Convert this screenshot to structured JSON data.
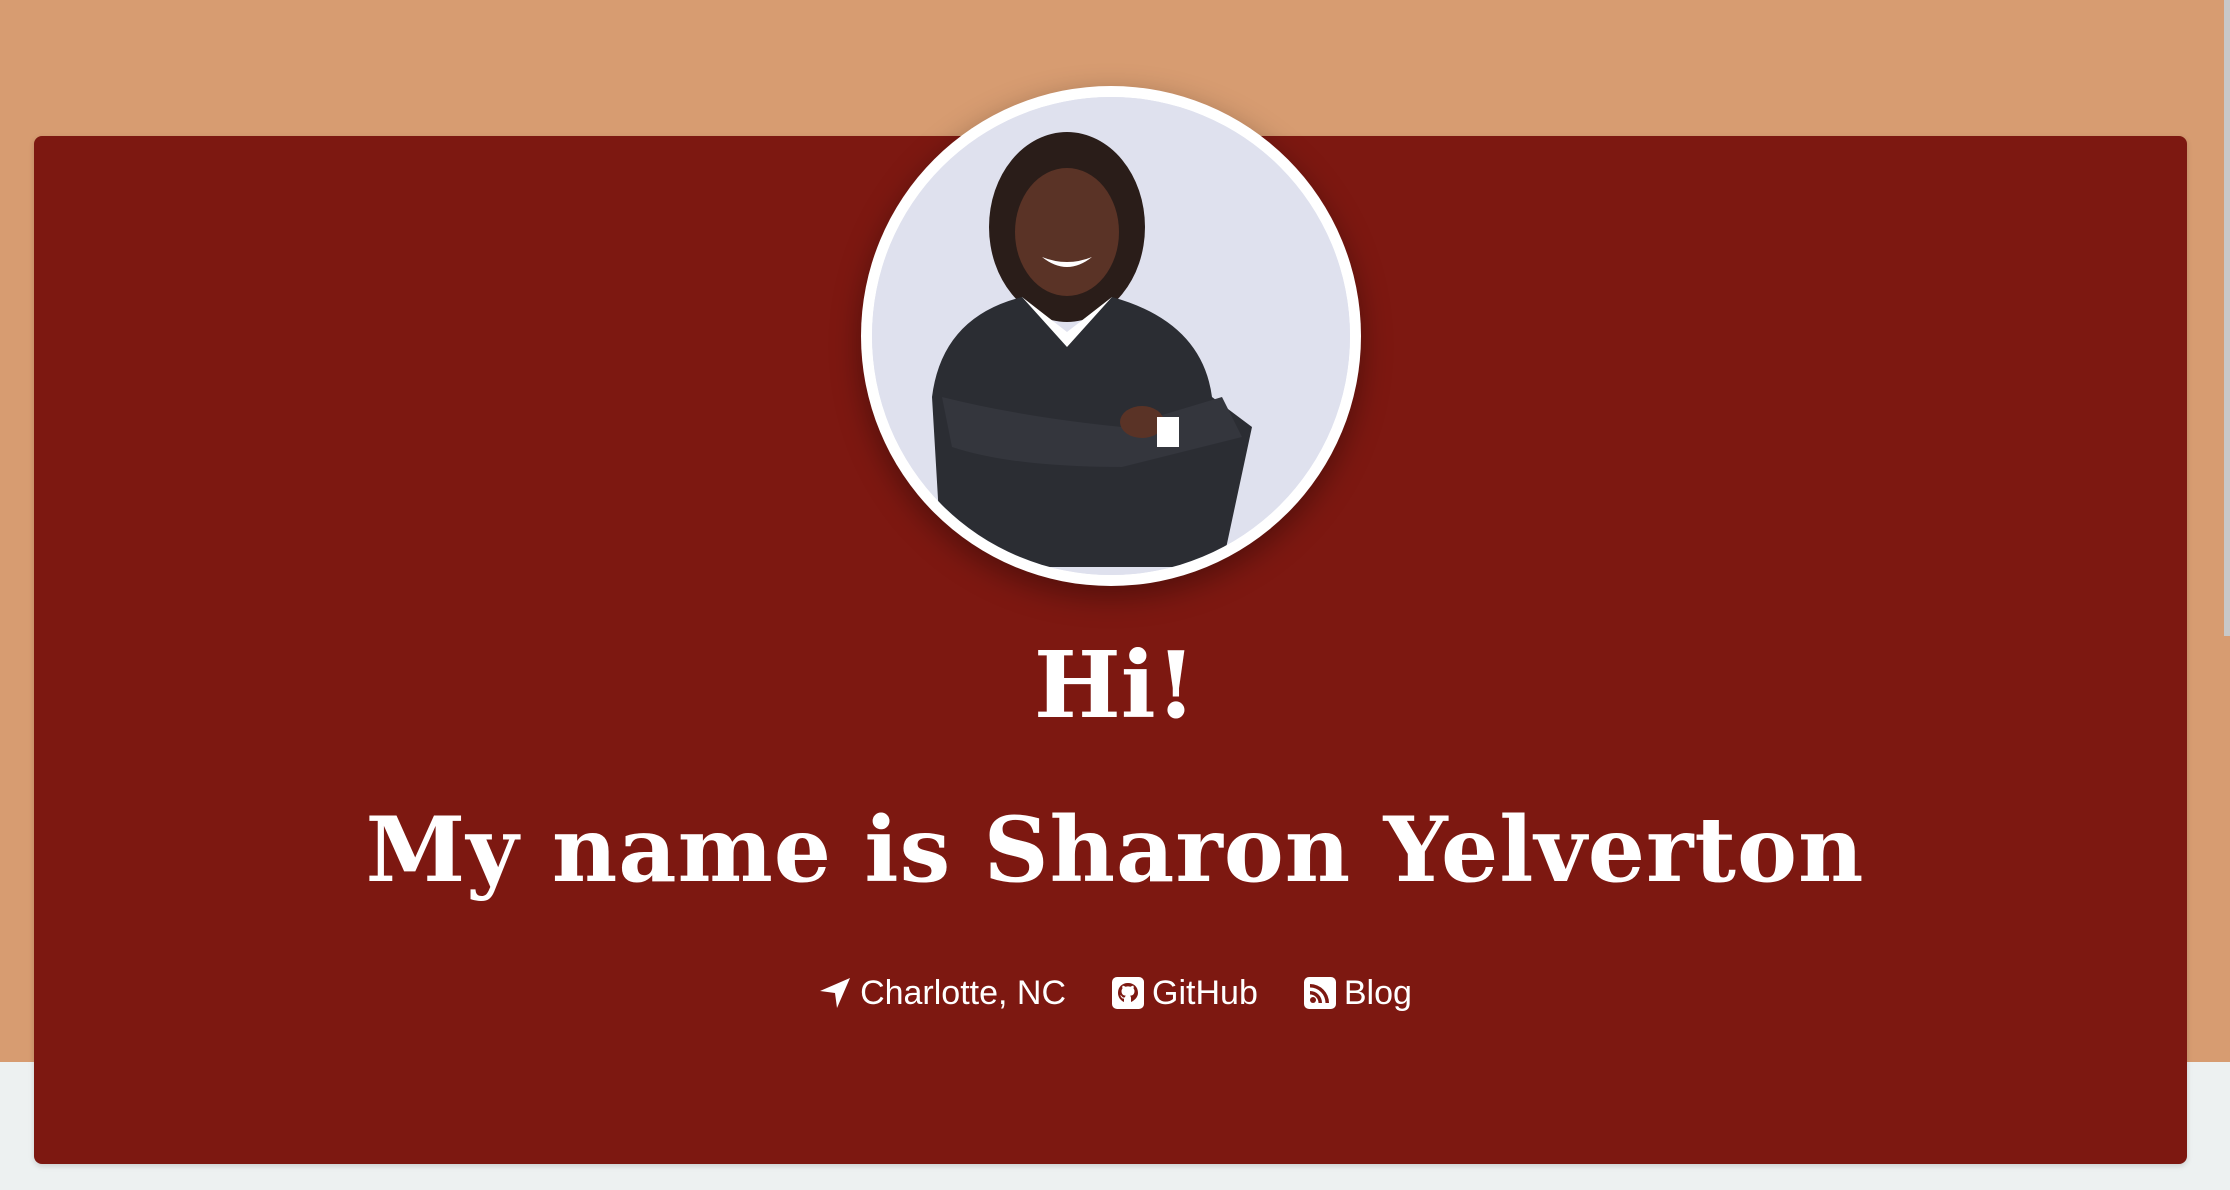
{
  "colors": {
    "page_top": "#d79c71",
    "page_bottom": "#edf1f1",
    "hero_background": "#7d1811",
    "text": "#ffffff"
  },
  "hero": {
    "greeting": "Hi!",
    "name_line": "My name is Sharon Yelverton",
    "links": [
      {
        "icon": "location-arrow-icon",
        "label": "Charlotte, NC"
      },
      {
        "icon": "github-icon",
        "label": "GitHub"
      },
      {
        "icon": "rss-icon",
        "label": "Blog"
      }
    ]
  }
}
